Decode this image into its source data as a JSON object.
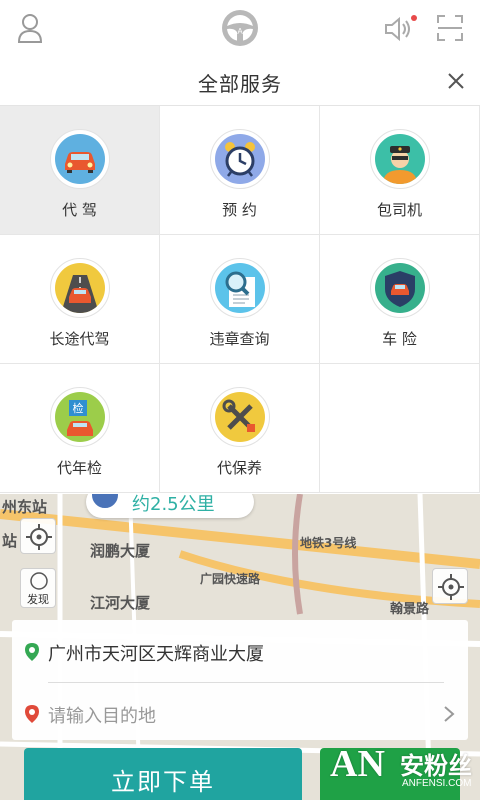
{
  "topbar": {
    "icons": [
      "user-icon",
      "steering-wheel-icon",
      "speaker-icon",
      "scan-icon"
    ],
    "notification_dot_color": "#e84a4a"
  },
  "panel": {
    "title": "全部服务",
    "close_icon": "close-icon"
  },
  "services": [
    {
      "label": "代 驾",
      "icon": "car-icon",
      "active": true
    },
    {
      "label": "预 约",
      "icon": "alarm-clock-icon",
      "active": false
    },
    {
      "label": "包司机",
      "icon": "chauffeur-icon",
      "active": false
    },
    {
      "label": "长途代驾",
      "icon": "highway-car-icon",
      "active": false
    },
    {
      "label": "违章查询",
      "icon": "magnifier-document-icon",
      "active": false
    },
    {
      "label": "车 险",
      "icon": "shield-car-icon",
      "active": false
    },
    {
      "label": "代年检",
      "icon": "inspection-icon",
      "active": false
    },
    {
      "label": "代保养",
      "icon": "tools-icon",
      "active": false
    }
  ],
  "map": {
    "distance": "约2.5公里",
    "labels": [
      "润鹏大厦",
      "江河大厦",
      "广园快速路",
      "地铁3号线",
      "翰景路",
      "州东站",
      "站"
    ],
    "discover_label": "发现"
  },
  "address": {
    "from": "广州市天河区天辉商业大厦",
    "to_placeholder": "请输入目的地"
  },
  "actions": {
    "order_label": "立即下单"
  },
  "watermark": {
    "logo": "AN",
    "cn": "安粉丝",
    "en": "ANFENSI.COM"
  },
  "colors": {
    "accent": "#20a4a0",
    "distance_text": "#2eb0a4",
    "green_button": "#1fa146"
  }
}
